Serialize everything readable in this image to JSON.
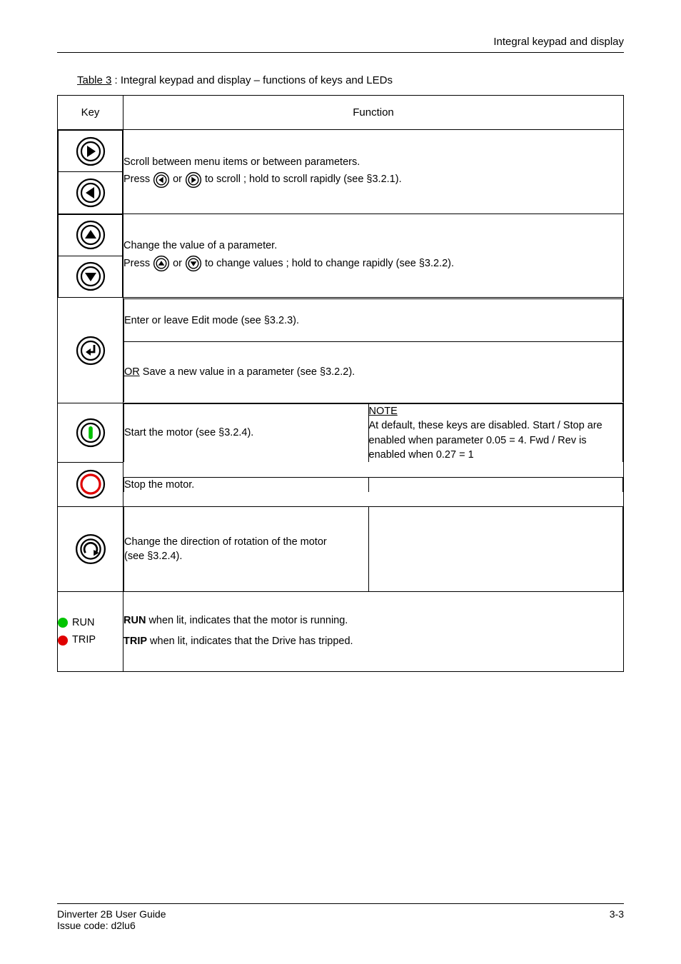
{
  "header": {
    "right": "Integral keypad and display"
  },
  "table": {
    "caption_prefix": "Table 3",
    "caption": " :  Integral keypad and display – functions of keys and LEDs",
    "head": {
      "key": "Key",
      "function": "Function"
    },
    "rows": {
      "lr": {
        "title": "Scroll between menu items or between parameters.",
        "line_a": "Press ",
        "line_b": " or ",
        "line_c": " to scroll ; hold to scroll rapidly (see §3.2.1)."
      },
      "ud": {
        "title": "Change the value of a parameter.",
        "line_a": "Press ",
        "line_b": " or ",
        "line_c": " to change values ; hold to change rapidly (see §3.2.2)."
      },
      "enter": {
        "cell1": "Enter or leave Edit mode (see §3.2.3).",
        "cell2_a": "OR",
        "cell2_b": "  Save a new value in a parameter (see §3.2.2)."
      },
      "start": "Start the motor (see §3.2.4).",
      "stop": "Stop the motor.",
      "revA": "Change the direction of rotation of the motor",
      "revB": "(see §3.2.4).",
      "note_a": "NOTE",
      "note_b": "At default, these keys are disabled.  Start / Stop are enabled when parameter 0.05 = 4.  Fwd / Rev is enabled when 0.27 = 1",
      "leds": {
        "run": "RUN",
        "run_desc": "  when lit, indicates that the motor is running.",
        "trip": "TRIP",
        "trip_desc": "  when lit, indicates that the Drive has tripped."
      }
    }
  },
  "footer": {
    "left": "Dinverter 2B User Guide",
    "right": "3-3",
    "issue": "Issue code:  d2lu6"
  }
}
